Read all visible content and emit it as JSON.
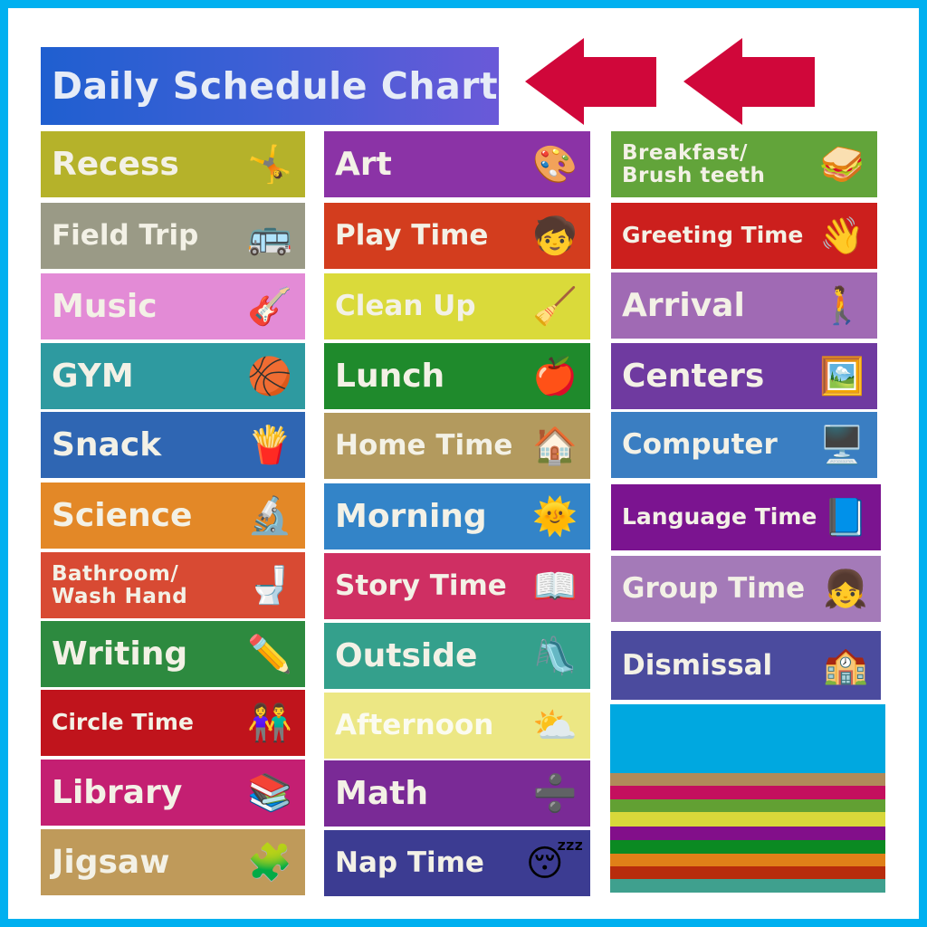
{
  "title": "Daily Schedule Chart",
  "colors": {
    "frame": "#00b0f0",
    "arrow": "#d0073a",
    "title_start": "#1f5fd0",
    "title_end": "#6a59d8"
  },
  "arrows": [
    {
      "name": "left-arrow-1",
      "direction": "left"
    },
    {
      "name": "left-arrow-2",
      "direction": "left"
    }
  ],
  "columns": [
    {
      "cards": [
        {
          "label": "Recess",
          "color": "#b5b22a",
          "icon": "jump-rope-kids-icon",
          "glyph": "🤸"
        },
        {
          "label": "Field Trip",
          "color": "#9a9a86",
          "icon": "school-bus-icon",
          "glyph": "🚌"
        },
        {
          "label": "Music",
          "color": "#e38bd6",
          "icon": "guitar-icon",
          "glyph": "🎸"
        },
        {
          "label": "GYM",
          "color": "#2e9aa0",
          "icon": "basketball-icon",
          "glyph": "🏀"
        },
        {
          "label": "Snack",
          "color": "#2f66b3",
          "icon": "chips-bag-icon",
          "glyph": "🍟"
        },
        {
          "label": "Science",
          "color": "#e38827",
          "icon": "lab-equipment-icon",
          "glyph": "🔬"
        },
        {
          "label": "Bathroom/\nWash Hand",
          "color": "#d84a33",
          "icon": "toilet-faucet-icon",
          "glyph": "🚽"
        },
        {
          "label": "Writing",
          "color": "#2d8a3f",
          "icon": "pencil-paper-icon",
          "glyph": "✏️"
        },
        {
          "label": "Circle Time",
          "color": "#c0141c",
          "icon": "kids-circle-icon",
          "glyph": "👫"
        },
        {
          "label": "Library",
          "color": "#c41f72",
          "icon": "book-stack-icon",
          "glyph": "📚"
        },
        {
          "label": "Jigsaw",
          "color": "#bf9a5a",
          "icon": "puzzle-icon",
          "glyph": "🧩"
        }
      ]
    },
    {
      "cards": [
        {
          "label": "Art",
          "color": "#8b33a6",
          "icon": "easel-girl-icon",
          "glyph": "🎨"
        },
        {
          "label": "Play Time",
          "color": "#d33d1e",
          "icon": "kids-playing-icon",
          "glyph": "🧒"
        },
        {
          "label": "Clean Up",
          "color": "#dada3a",
          "icon": "boy-cleaning-icon",
          "glyph": "🧹"
        },
        {
          "label": "Lunch",
          "color": "#1f8a2c",
          "icon": "lunch-bag-icon",
          "glyph": "🍎"
        },
        {
          "label": "Home Time",
          "color": "#b39a5e",
          "icon": "house-icon",
          "glyph": "🏠"
        },
        {
          "label": "Morning",
          "color": "#3384c8",
          "icon": "smiling-sun-icon",
          "glyph": "🌞"
        },
        {
          "label": "Story Time",
          "color": "#cf2f63",
          "icon": "family-reading-icon",
          "glyph": "📖"
        },
        {
          "label": "Outside",
          "color": "#34a08c",
          "icon": "slide-icon",
          "glyph": "🛝"
        },
        {
          "label": "Afternoon",
          "color": "#ece784",
          "icon": "sun-hill-icon",
          "glyph": "⛅"
        },
        {
          "label": "Math",
          "color": "#7a2a96",
          "icon": "math-symbols-icon",
          "glyph": "➗"
        },
        {
          "label": "Nap Time",
          "color": "#3c3c92",
          "icon": "sleeping-girl-icon",
          "glyph": "😴"
        }
      ]
    },
    {
      "cards": [
        {
          "label": "Breakfast/\nBrush teeth",
          "color": "#62a43a",
          "icon": "sandwich-tooth-icon",
          "glyph": "🥪"
        },
        {
          "label": "Greeting Time",
          "color": "#cc1f1d",
          "icon": "waving-hands-icon",
          "glyph": "👋"
        },
        {
          "label": "Arrival",
          "color": "#a06ab4",
          "icon": "kids-walking-icon",
          "glyph": "🚶"
        },
        {
          "label": "Centers",
          "color": "#6f3aa0",
          "icon": "boy-easel-icon",
          "glyph": "🖼️"
        },
        {
          "label": "Computer",
          "color": "#3a7ec2",
          "icon": "monitor-icon",
          "glyph": "🖥️"
        },
        {
          "label": "Language Time",
          "color": "#7b1490",
          "icon": "boy-reading-icon",
          "glyph": "📘"
        },
        {
          "label": "Group Time",
          "color": "#a47ab8",
          "icon": "kids-at-desks-icon",
          "glyph": "👧"
        },
        {
          "label": "Dismissal",
          "color": "#4b4b9e",
          "icon": "schoolhouse-icon",
          "glyph": "🏫"
        }
      ]
    }
  ],
  "blank_cards": [
    "#00a8e0",
    "#b08a5a",
    "#c40f5e",
    "#62a033",
    "#d8d83a",
    "#820f8a",
    "#0b8a22",
    "#e08018",
    "#b82c0c",
    "#3fa08e"
  ]
}
